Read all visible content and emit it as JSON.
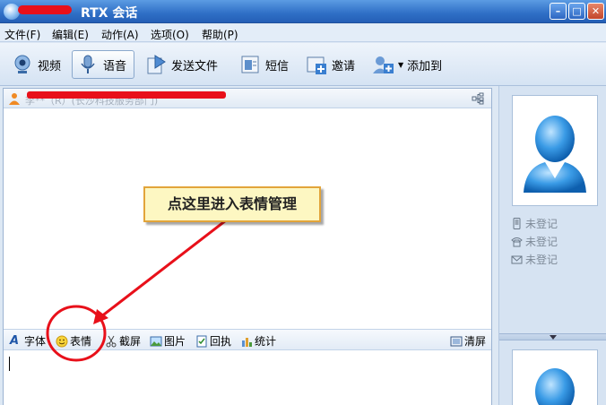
{
  "window": {
    "title": "RTX 会话",
    "controls": [
      "minimize",
      "maximize",
      "close"
    ]
  },
  "menu": [
    "文件(F)",
    "编辑(E)",
    "动作(A)",
    "选项(O)",
    "帮助(P)"
  ],
  "toolbar": {
    "video": "视频",
    "voice": "语音",
    "send_file": "发送文件",
    "sms": "短信",
    "invite": "邀请",
    "add_to": "添加到"
  },
  "contact": {
    "name": "李**（R）(长沙科技服务部门)"
  },
  "format_bar": {
    "font": "字体",
    "emoji": "表情",
    "screenshot": "截屏",
    "image": "图片",
    "receipt": "回执",
    "stats": "统计",
    "clear": "清屏"
  },
  "side_panel": {
    "mobile": "未登记",
    "phone": "未登记",
    "email": "未登记"
  },
  "annotation": {
    "callout_text": "点这里进入表情管理"
  },
  "colors": {
    "title_bar": "#2f6fc6",
    "annotation_red": "#e8101a",
    "callout_bg": "#fdf7c2"
  }
}
